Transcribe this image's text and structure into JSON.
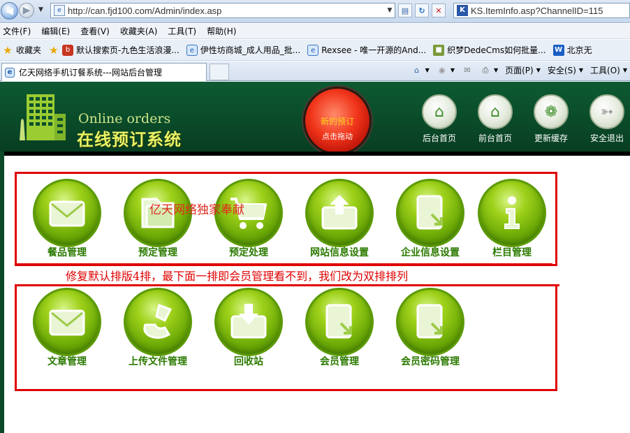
{
  "browser": {
    "address": "http://can.fjd100.com/Admin/index.asp",
    "search_text": "KS.ItemInfo.asp?ChannelID=115",
    "menu": [
      "文件(F)",
      "编辑(E)",
      "查看(V)",
      "收藏夹(A)",
      "工具(T)",
      "帮助(H)"
    ],
    "favorites_label": "收藏夹",
    "favorites": [
      {
        "label": "默认搜索页-九色生活浪漫...",
        "icon": "baidu-icon"
      },
      {
        "label": "伊性坊商城_成人用品_批...",
        "icon": "ie-page-icon"
      },
      {
        "label": "Rexsee - 唯一开源的And...",
        "icon": "ie-page-icon"
      },
      {
        "label": "织梦DedeCms如何批量...",
        "icon": "dede-icon"
      },
      {
        "label": "北京无",
        "icon": "w-icon"
      }
    ],
    "tab_title": "亿天网络手机订餐系统---网站后台管理",
    "commands": {
      "page": "页面(P)",
      "safety": "安全(S)",
      "tools": "工具(O)"
    }
  },
  "header": {
    "logo_en": "Online orders",
    "logo_cn": "在线预订系统",
    "order_button": {
      "title": "新的预订",
      "subtitle": "点击拖动"
    },
    "nav": [
      {
        "label": "后台首页",
        "icon": "admin-home-icon"
      },
      {
        "label": "前台首页",
        "icon": "house-icon"
      },
      {
        "label": "更新缓存",
        "icon": "leaf-icon"
      },
      {
        "label": "安全退出",
        "icon": "exit-icon"
      }
    ]
  },
  "modules": {
    "row1": [
      {
        "label": "餐品管理",
        "icon": "envelope-icon"
      },
      {
        "label": "预定管理",
        "icon": "folder-icon"
      },
      {
        "label": "预定处理",
        "icon": "cart-icon"
      },
      {
        "label": "网站信息设置",
        "icon": "upload-envelope-icon"
      },
      {
        "label": "企业信息设置",
        "icon": "document-arrow-icon"
      },
      {
        "label": "栏目管理",
        "icon": "info-icon"
      }
    ],
    "row2": [
      {
        "label": "文章管理",
        "icon": "envelope-icon"
      },
      {
        "label": "上传文件管理",
        "icon": "phone-icon"
      },
      {
        "label": "回收站",
        "icon": "download-box-icon"
      },
      {
        "label": "会员管理",
        "icon": "document-arrow-icon"
      },
      {
        "label": "会员密码管理",
        "icon": "document-arrow-icon"
      }
    ]
  },
  "annotations": {
    "watermark": "亿天网络独家奉献",
    "fix_note": "修复默认排版4排，最下面一排即会员管理看不到，我们改为双排排列"
  },
  "colors": {
    "header_green": "#0c4f2c",
    "icon_green": "#6aa806",
    "label_green": "#2b7a00",
    "annotation_red": "#e00000",
    "order_red": "#f0341a"
  }
}
